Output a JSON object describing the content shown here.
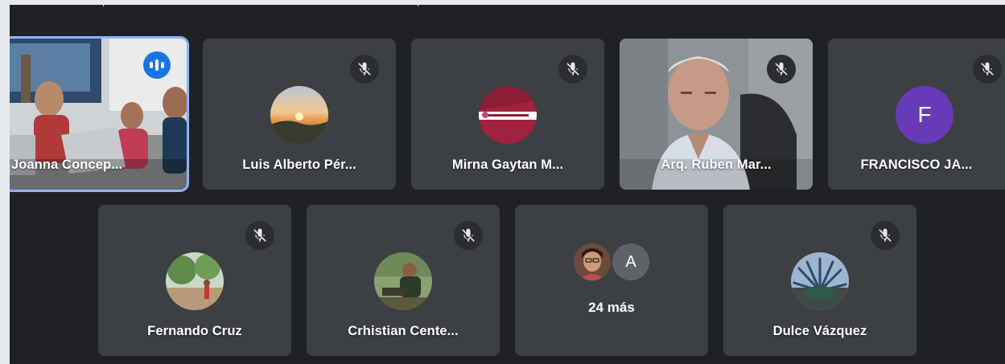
{
  "row1": [
    {
      "name": "Joanna Concep...",
      "kind": "video-group",
      "speaking": true
    },
    {
      "name": "Luis Alberto Pér...",
      "kind": "avatar-photo",
      "muted": true
    },
    {
      "name": "Mirna Gaytan M...",
      "kind": "avatar-logo",
      "muted": true
    },
    {
      "name": "Arq. Ruben Mar...",
      "kind": "video-man",
      "muted": true
    },
    {
      "name": "FRANCISCO JA...",
      "kind": "avatar-letter",
      "letter": "F",
      "muted": true
    }
  ],
  "row2": [
    {
      "name": "Fernando Cruz",
      "kind": "avatar-photo",
      "muted": true
    },
    {
      "name": "Crhistian Cente...",
      "kind": "avatar-photo",
      "muted": true
    },
    {
      "more_letter": "A",
      "more_text": "24 más"
    },
    {
      "name": "Dulce Vázquez",
      "kind": "avatar-photo",
      "muted": true
    }
  ],
  "colors": {
    "stage_bg": "#202124",
    "tile_bg": "#3c4043",
    "active_border": "#8ab4f8",
    "speaking_badge": "#1a73e8",
    "letter_avatar_bg": "#673ab7"
  },
  "icons": {
    "mute": "mic-off-icon",
    "speaking": "audio-levels-icon"
  }
}
